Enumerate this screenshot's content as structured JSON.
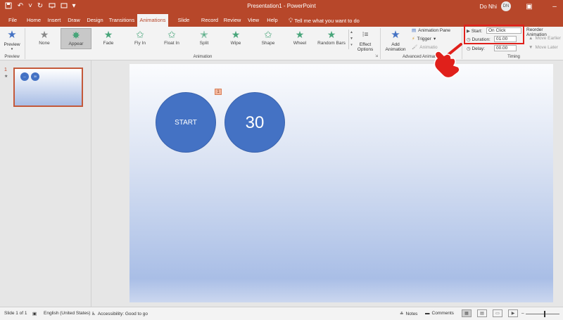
{
  "window": {
    "title": "Presentation1 - PowerPoint",
    "user_name": "Do Nhi",
    "user_initials": "DN"
  },
  "quick_access": {
    "save_icon": "floppy-icon",
    "undo_icon": "undo-icon",
    "redo_icon": "redo-icon",
    "present_icon": "present-icon",
    "customize_icon": "more-icon"
  },
  "tabs": [
    {
      "label": "File"
    },
    {
      "label": "Home"
    },
    {
      "label": "Insert"
    },
    {
      "label": "Draw"
    },
    {
      "label": "Design"
    },
    {
      "label": "Transitions"
    },
    {
      "label": "Animations"
    },
    {
      "label": "Slide Show"
    },
    {
      "label": "Record"
    },
    {
      "label": "Review"
    },
    {
      "label": "View"
    },
    {
      "label": "Help"
    }
  ],
  "tell_me": "Tell me what you want to do",
  "ribbon": {
    "preview": {
      "label": "Preview",
      "group": "Preview"
    },
    "animation_group": "Animation",
    "animations": [
      {
        "label": "None",
        "icon": "star-icon"
      },
      {
        "label": "Appear",
        "icon": "star-icon"
      },
      {
        "label": "Fade",
        "icon": "star-icon"
      },
      {
        "label": "Fly In",
        "icon": "star-icon"
      },
      {
        "label": "Float In",
        "icon": "star-icon"
      },
      {
        "label": "Split",
        "icon": "star-icon"
      },
      {
        "label": "Wipe",
        "icon": "star-icon"
      },
      {
        "label": "Shape",
        "icon": "star-icon"
      },
      {
        "label": "Wheel",
        "icon": "star-icon"
      },
      {
        "label": "Random Bars",
        "icon": "star-icon"
      }
    ],
    "effect_options": {
      "line1": "Effect",
      "line2": "Options"
    },
    "advanced": {
      "group": "Advanced Animati",
      "add_line1": "Add",
      "add_line2": "Animation",
      "pane": "Animation Pane",
      "trigger": "Trigger",
      "painter": "Animatio"
    },
    "timing": {
      "group": "Timing",
      "start_label": "Start:",
      "start_value": "On Click",
      "duration_label": "Duration:",
      "duration_value": "01.00",
      "delay_label": "Delay:",
      "delay_value": "00.00",
      "reorder": "Reorder Animation",
      "move_earlier": "Move Earlier",
      "move_later": "Move Later"
    }
  },
  "thumbnails": {
    "slide_number": "1",
    "star": "★",
    "shape1": "—",
    "shape2": "30"
  },
  "slide": {
    "animation_tag": "1",
    "shape_start": "START",
    "shape_number": "30"
  },
  "status": {
    "slide_info": "Slide 1 of 1",
    "language": "English (United States)",
    "accessibility": "Accessibility: Good to go",
    "notes": "Notes",
    "comments": "Comments"
  },
  "colors": {
    "brand": "#b7472a",
    "shape_fill": "#4472c4",
    "highlight": "#e0201b"
  }
}
